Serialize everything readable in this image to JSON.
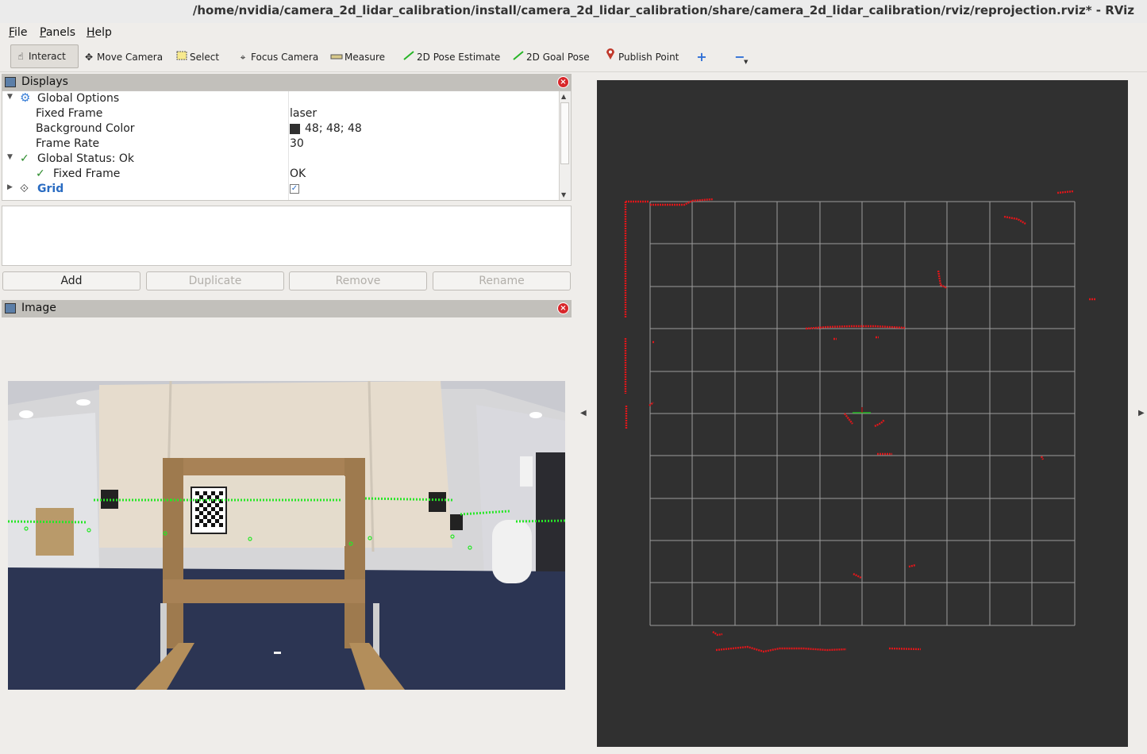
{
  "window": {
    "title": "/home/nvidia/camera_2d_lidar_calibration/install/camera_2d_lidar_calibration/share/camera_2d_lidar_calibration/rviz/reprojection.rviz* - RViz"
  },
  "menubar": {
    "file": {
      "mnemonic": "F",
      "rest": "ile"
    },
    "panels": {
      "mnemonic": "P",
      "rest": "anels"
    },
    "help": {
      "mnemonic": "H",
      "rest": "elp"
    }
  },
  "toolbar": {
    "interact": "Interact",
    "move_camera": "Move Camera",
    "select": "Select",
    "focus_camera": "Focus Camera",
    "measure": "Measure",
    "pose_estimate": "2D Pose Estimate",
    "goal_pose": "2D Goal Pose",
    "publish_point": "Publish Point"
  },
  "displays_panel": {
    "title": "Displays",
    "rows": {
      "global_options": "Global Options",
      "fixed_frame_label": "Fixed Frame",
      "fixed_frame_value": "laser",
      "background_color_label": "Background Color",
      "background_color_value": "48; 48; 48",
      "frame_rate_label": "Frame Rate",
      "frame_rate_value": "30",
      "global_status": "Global Status: Ok",
      "status_fixed_frame_label": "Fixed Frame",
      "status_fixed_frame_value": "OK",
      "grid": "Grid"
    },
    "buttons": {
      "add": "Add",
      "duplicate": "Duplicate",
      "remove": "Remove",
      "rename": "Rename"
    }
  },
  "image_panel": {
    "title": "Image"
  },
  "colors": {
    "background": "#303030",
    "laser_points": "#e0161a",
    "grid_lines": "#a0a0a0",
    "reprojected_points": "#27e727"
  }
}
